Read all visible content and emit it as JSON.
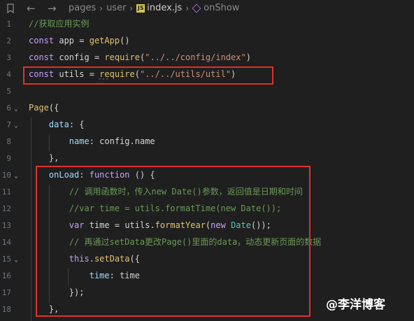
{
  "breadcrumb": {
    "items": [
      "pages",
      "user",
      "index.js",
      "onShow"
    ]
  },
  "code": {
    "lines": [
      {
        "num": "1",
        "text": "//获取应用实例"
      },
      {
        "num": "2",
        "text": "const app = getApp()"
      },
      {
        "num": "3",
        "text": "const config = require(\"../../config/index\")"
      },
      {
        "num": "4",
        "text": "const utils = require(\"../../utils/util\")"
      },
      {
        "num": "5",
        "text": ""
      },
      {
        "num": "6",
        "text": "Page({"
      },
      {
        "num": "7",
        "text": "    data: {"
      },
      {
        "num": "8",
        "text": "        name: config.name"
      },
      {
        "num": "9",
        "text": "    },"
      },
      {
        "num": "10",
        "text": "    onLoad: function () {"
      },
      {
        "num": "11",
        "text": "        // 调用函数时，传入new Date()参数，返回值是日期和时间"
      },
      {
        "num": "12",
        "text": "        //var time = utils.formatTime(new Date());"
      },
      {
        "num": "13",
        "text": "        var time = utils.formatYear(new Date());"
      },
      {
        "num": "14",
        "text": "        // 再通过setData更改Page()里面的data，动态更新页面的数据"
      },
      {
        "num": "15",
        "text": "        this.setData({"
      },
      {
        "num": "16",
        "text": "            time: time"
      },
      {
        "num": "17",
        "text": "        });"
      },
      {
        "num": "18",
        "text": "    },"
      }
    ]
  },
  "watermark": "@李洋博客",
  "colors": {
    "background": "#1f1f1f",
    "highlight_box": "#e0302a",
    "comment": "#6a9955",
    "keyword": "#c8a0ff",
    "function": "#e3c16f",
    "string": "#ce9178"
  }
}
